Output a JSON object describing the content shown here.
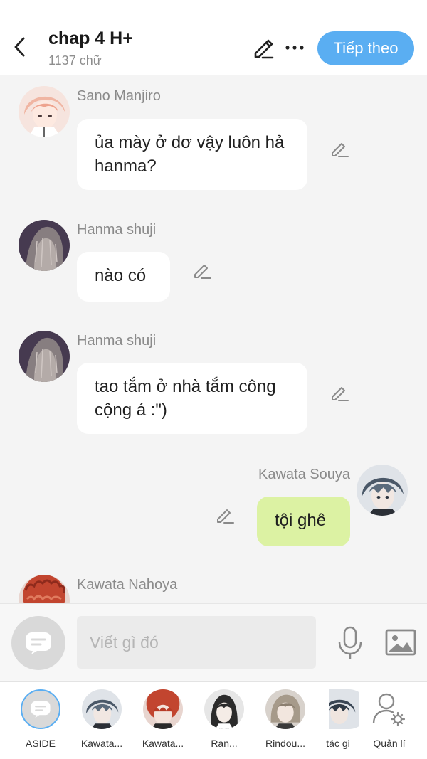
{
  "header": {
    "title": "chap 4 H+",
    "word_count": "1137 chữ",
    "next_label": "Tiếp theo"
  },
  "messages": [
    {
      "sender": "Sano Manjiro",
      "text": "ủa mày ở dơ vậy luôn hả hanma?",
      "align": "left"
    },
    {
      "sender": "Hanma shuji",
      "text": "nào có",
      "align": "left"
    },
    {
      "sender": "Hanma shuji",
      "text": "tao tắm ở nhà tắm công cộng á :\")",
      "align": "left"
    },
    {
      "sender": "Kawata Souya",
      "text": "tội ghê",
      "align": "right"
    },
    {
      "sender": "Kawata Nahoya",
      "text": "",
      "align": "left"
    }
  ],
  "composer": {
    "placeholder": "Viết gì đó"
  },
  "characters": [
    {
      "label": "ASIDE"
    },
    {
      "label": "Kawata..."
    },
    {
      "label": "Kawata..."
    },
    {
      "label": "Ran..."
    },
    {
      "label": "Rindou..."
    },
    {
      "label": "tác gi"
    },
    {
      "label": "Quản lí"
    }
  ],
  "colors": {
    "accent": "#5aaef2",
    "own_bubble": "#dcf2a3",
    "other_bubble": "#ffffff",
    "background": "#f4f4f4"
  }
}
